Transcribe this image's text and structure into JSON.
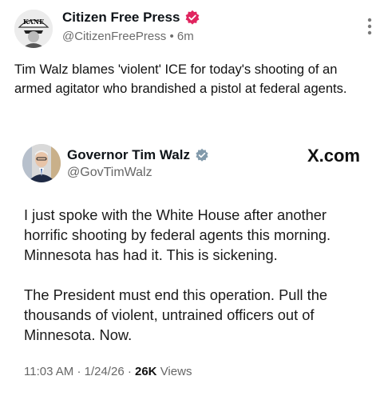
{
  "post": {
    "author_name": "Citizen Free Press",
    "avatar_text": "KANE",
    "handle": "@CitizenFreePress",
    "separator": "•",
    "time": "6m",
    "text": "Tim Walz blames 'violent' ICE for today's shooting of an armed agitator who brandished a pistol at federal agents.",
    "colors": {
      "verified_badge": "#e0245e"
    },
    "icons": {
      "badge": "verified-badge-icon",
      "menu": "more-vertical-icon"
    }
  },
  "embedded": {
    "author_name": "Governor Tim Walz",
    "handle": "@GovTimWalz",
    "source": "X.com",
    "paragraph_1": "I just spoke with the White House after another horrific shooting by federal agents this morning. Minnesota has had it. This is sickening.",
    "paragraph_2": "The President must end this operation. Pull the thousands of violent, untrained officers out of Minnesota. Now.",
    "time": "11:03 AM",
    "dot": "·",
    "date": "1/24/26",
    "dot2": "·",
    "views_count": "26K",
    "views_label": "Views",
    "colors": {
      "verified_badge": "#829aab"
    },
    "icons": {
      "badge": "grey-verified-badge-icon"
    }
  }
}
